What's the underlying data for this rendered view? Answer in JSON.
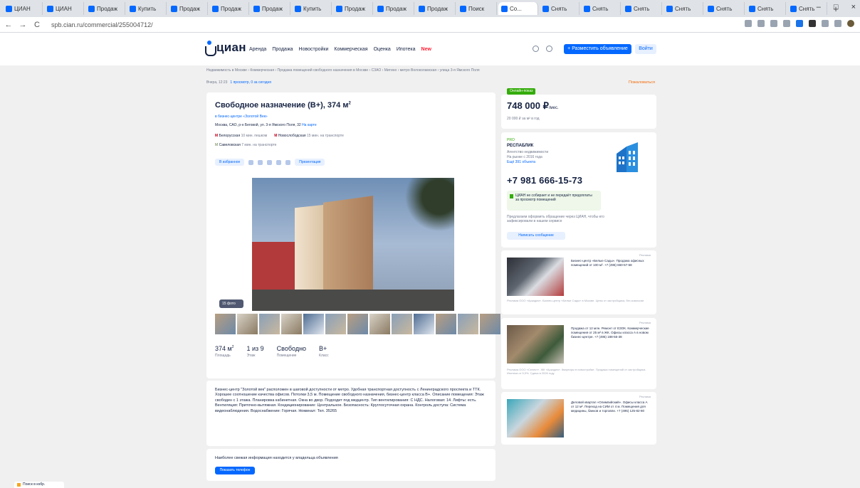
{
  "browser": {
    "tabs": [
      "ЦИАН",
      "ЦИАН",
      "Продаж",
      "Купить",
      "Продаж",
      "Продаж",
      "Продаж",
      "Купить",
      "Продаж",
      "Продаж",
      "Продаж",
      "Поиск",
      "Со...",
      "Снять",
      "Снять",
      "Снять",
      "Снять",
      "Снять",
      "Снять",
      "Снять"
    ],
    "active_tab_index": 12,
    "new_tab": "+",
    "window_controls": [
      "–",
      "□",
      "×"
    ],
    "nav": [
      "←",
      "→",
      "C"
    ],
    "url": "spb.cian.ru/commercial/255004712/"
  },
  "header": {
    "logo": "циан",
    "nav": [
      "Аренда",
      "Продажа",
      "Новостройки",
      "Коммерческая",
      "Оценка",
      "Ипотека"
    ],
    "nav_new": "New",
    "post_button": "+ Разместить объявление",
    "login_button": "Войти"
  },
  "breadcrumbs": "Недвижимость в Москве  ›  Коммерческая  ›  Продажа помещений свободного назначения в Москве  ›  СЗАО  ›  Митино  ›  метро Волоколамская  ›  улица 3-я Ямского Поля",
  "subcrumbs": {
    "date": "Вчера, 12:23",
    "views": "1 просмотр, 0 за сегодня",
    "complain": "Пожаловаться"
  },
  "listing": {
    "title": "Свободное назначение (B+), 374 м",
    "title_sup": "2",
    "bc_link": "в бизнес-центре «Золотой Век»",
    "address_prefix": "Москва, САО, р-н Беговой, ул. 3-я Ямского Поля, 32",
    "address_link": "На карте",
    "metro": [
      {
        "name": "Белорусская",
        "time": "10 мин. пешком"
      },
      {
        "name": "Новослободская",
        "time": "15 мин. на транспорте"
      },
      {
        "name": "Савеловская",
        "time": "7 мин. на транспорте"
      }
    ],
    "action_pill": "В избранное",
    "presentation": "Презентация",
    "photo_count": "15 фото",
    "thumbs_count": 13,
    "facts": [
      {
        "value": "374 м",
        "sup": "2",
        "label": "Площадь"
      },
      {
        "value": "1 из 9",
        "sup": "",
        "label": "Этаж"
      },
      {
        "value": "Свободно",
        "sup": "",
        "label": "Помещение"
      },
      {
        "value": "B+",
        "sup": "",
        "label": "Класс"
      }
    ],
    "description": "Бизнес-центр \"Золотой век\" расположен в шаговой доступности от метро. Удобная транспортная доступность с Ленинградского проспекта и ТТК. Хорошее соотношение качества офисов. Потолки 3,5 м. Помещение свободного назначения, бизнес-центр класса B+. Описание помещения: Этаж свободен с 1 этажа. Планировка кабинетная. Окна во двор. Подходит под медцентр. Тип вентилирования: С НДС. Налоговая: 14. Лифты: есть. Вентиляция: Приточно-вытяжная. Кондиционирование: Центральное. Безопасность: Круглосуточная охрана. Контроль доступа: Система видеонаблюдения. Водоснабжение: Горячая. Номинал: Тел. 35265",
    "contact_text": "Наиболее свежая информация находится у владельца объявления",
    "show_phone": "Показать телефон"
  },
  "sidebar": {
    "online_badge": "Онлайн-показ",
    "price": "748 000 ₽",
    "price_unit": "/мес.",
    "price_sub": "20 000 ₽ за м² в год",
    "agent_pro": "PRO",
    "agent_name": "РЕСПАБЛИК",
    "agent_info": [
      "Агентство недвижимости",
      "На рынке с 2016 года"
    ],
    "agent_link": "Ещё 391 объекта",
    "phone": "+7 981 666-15-73",
    "notice": "ЦИАН не собирает и не передаёт предоплаты за просмотр помещений",
    "agent_note": "Предлагаем оформить обращение через ЦИАН, чтобы его зафиксировали в нашем сервисе",
    "write_button": "Написать сообщение",
    "ads": [
      {
        "tag": "Реклама",
        "text": "Бизнес-центр «Белые Сады». Продажа офисных помещений от 100 м². +7 (495) 660-57-68",
        "foot": "Реклама ООО «Аркадия». Бизнес-центр «Белые Сады» в Москве. Цены от застройщика, без комиссии"
      },
      {
        "tag": "Реклама",
        "text": "Продажа от 12 млн. Ремонт от ЕЗОК. Коммерческие помещения от 25 м² в ЖК. Офисы класса А в новом бизнес-центре. +7 (495) 188-55-38",
        "foot": "Реклама ООО «Селект». ЖК «Аркадия». Квартиры в новостройке. Продажа помещений от застройщика. Ипотека от 5,9%. Сдача в 2026 году"
      },
      {
        "tag": "Реклама",
        "text": "Деловой квартал «Олимпийский». Офисы класса А от 12 м². Переход на СИМ от 4 м. Помещения для медицины, банков и торговли. +7 (495) 125-82-80",
        "foot": ""
      }
    ]
  },
  "saved_search": "Поиск в избр.",
  "colors": {
    "brand": "#0468ff",
    "text": "#152242",
    "accent_green": "#34ac0a",
    "accent_red": "#ff1f34"
  }
}
